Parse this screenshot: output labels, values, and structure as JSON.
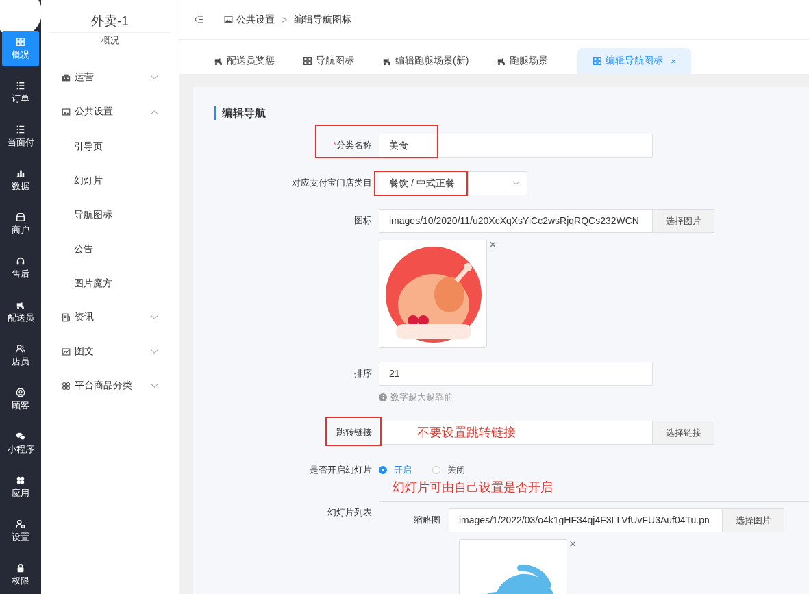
{
  "rail": {
    "items": [
      {
        "label": "概况",
        "selected": true
      },
      {
        "label": "订单",
        "selected": false
      },
      {
        "label": "当面付",
        "selected": false
      },
      {
        "label": "数据",
        "selected": false
      },
      {
        "label": "商户",
        "selected": false
      },
      {
        "label": "售后",
        "selected": false
      },
      {
        "label": "配送员",
        "selected": false
      },
      {
        "label": "店员",
        "selected": false
      },
      {
        "label": "顾客",
        "selected": false
      },
      {
        "label": "小程序",
        "selected": false
      },
      {
        "label": "应用",
        "selected": false
      },
      {
        "label": "设置",
        "selected": false
      },
      {
        "label": "权限",
        "selected": false
      }
    ]
  },
  "submenu": {
    "title": "外卖-1",
    "subtitle": "概况",
    "items": [
      {
        "label": "运营",
        "expanded": false
      },
      {
        "label": "公共设置",
        "expanded": true,
        "children": [
          {
            "label": "引导页"
          },
          {
            "label": "幻灯片"
          },
          {
            "label": "导航图标"
          },
          {
            "label": "公告"
          },
          {
            "label": "图片魔方"
          }
        ]
      },
      {
        "label": "资讯",
        "expanded": false
      },
      {
        "label": "图文",
        "expanded": false
      },
      {
        "label": "平台商品分类",
        "expanded": false
      }
    ]
  },
  "breadcrumb": {
    "items": [
      "公共设置",
      "编辑导航图标"
    ],
    "separator": ">"
  },
  "tabs": [
    {
      "label": "配送员奖惩",
      "selected": false
    },
    {
      "label": "导航图标",
      "selected": false
    },
    {
      "label": "编辑跑腿场景(新)",
      "selected": false
    },
    {
      "label": "跑腿场景",
      "selected": false
    },
    {
      "label": "编辑导航图标",
      "selected": true,
      "close": "×"
    }
  ],
  "form": {
    "title": "编辑导航",
    "fields": [
      {
        "kind": "text",
        "label": "分类名称",
        "required_mark": "*",
        "value": "美食",
        "label_boxed": true,
        "value_boxed": true
      },
      {
        "kind": "select",
        "label": "对应支付宝门店类目",
        "value": "餐饮 / 中式正餐",
        "label_boxed": false,
        "value_boxed": true
      },
      {
        "kind": "image",
        "label": "图标",
        "value": "images/10/2020/11/u20XcXqXsYiCc2wsRjqRQCs232WCN",
        "button": "选择图片",
        "remove": "×"
      },
      {
        "kind": "text",
        "label": "排序",
        "value": "21",
        "hint": "数字越大越靠前"
      },
      {
        "kind": "link",
        "label": "跳转链接",
        "note": "不要设置跳转链接",
        "button": "选择链接",
        "label_boxed": true,
        "value_boxed": false
      },
      {
        "kind": "radio",
        "label": "是否开启幻灯片",
        "options": [
          {
            "label": "开启",
            "selected": true
          },
          {
            "label": "关闭",
            "selected": false
          }
        ],
        "note": "幻灯片可由自己设置是否开启"
      },
      {
        "kind": "slides",
        "label": "幻灯片列表",
        "sub_label": "缩略图",
        "value": "images/1/2022/03/o4k1gHF34qj4F3LLVfUvFU3Auf04Tu.pn",
        "button": "选择图片",
        "remove": "×"
      }
    ]
  }
}
